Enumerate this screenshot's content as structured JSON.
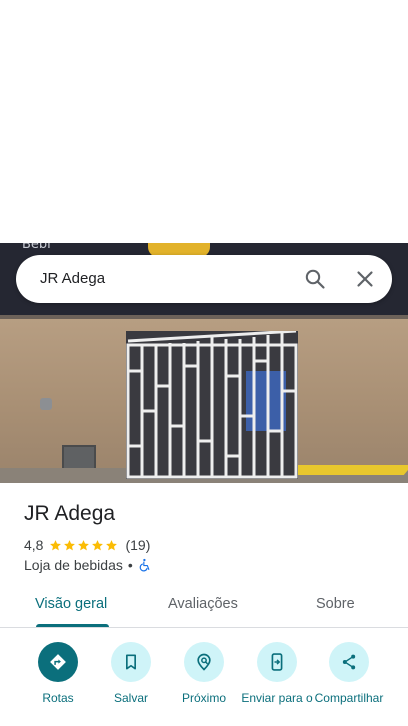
{
  "search": {
    "query": "JR Adega"
  },
  "photo": {
    "sign_text": "Bebi"
  },
  "place": {
    "name": "JR Adega",
    "rating": "4,8",
    "stars": 5,
    "review_count": "(19)",
    "category": "Loja de bebidas",
    "separator": "•"
  },
  "tabs": [
    {
      "label": "Visão geral"
    },
    {
      "label": "Avaliações"
    },
    {
      "label": "Sobre"
    }
  ],
  "actions": [
    {
      "label": "Rotas",
      "icon": "directions-icon"
    },
    {
      "label": "Salvar",
      "icon": "bookmark-icon"
    },
    {
      "label": "Próximo",
      "icon": "nearby-icon"
    },
    {
      "label": "Enviar para o",
      "icon": "send-to-phone-icon"
    },
    {
      "label": "Compartilhar",
      "icon": "share-icon"
    }
  ],
  "colors": {
    "accent": "#0b6f7c",
    "action_bg": "#cff4f8",
    "star": "#fbbc04",
    "accessibility": "#1a73e8"
  }
}
